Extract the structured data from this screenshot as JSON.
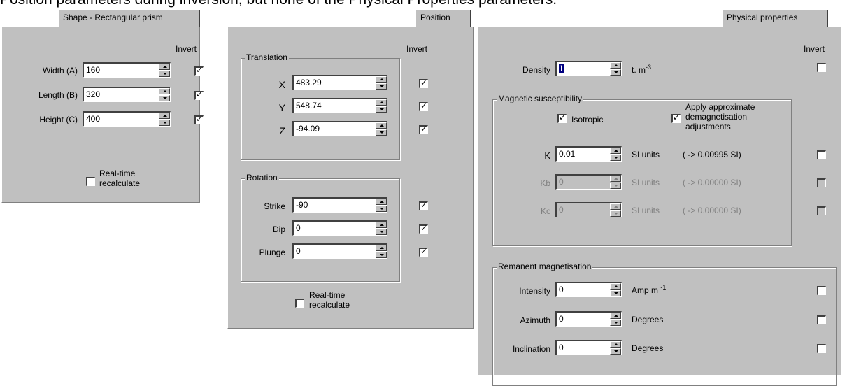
{
  "caption": "Position parameters during inversion, but none of the Physical Properties parameters.",
  "shape": {
    "tab": "Shape - Rectangular prism",
    "invert_label": "Invert",
    "rows": [
      {
        "label": "Width (A)",
        "value": "160",
        "invert": true
      },
      {
        "label": "Length (B)",
        "value": "320",
        "invert": true
      },
      {
        "label": "Height (C)",
        "value": "400",
        "invert": true
      }
    ],
    "realtime": {
      "label_line1": "Real-time",
      "label_line2": "recalculate",
      "checked": false
    }
  },
  "position": {
    "tab": "Position",
    "invert_label": "Invert",
    "translation": {
      "label": "Translation",
      "rows": [
        {
          "label": "X",
          "value": "483.29",
          "invert": true
        },
        {
          "label": "Y",
          "value": "548.74",
          "invert": true
        },
        {
          "label": "Z",
          "value": "-94.09",
          "invert": true
        }
      ]
    },
    "rotation": {
      "label": "Rotation",
      "rows": [
        {
          "label": "Strike",
          "value": "-90",
          "invert": true
        },
        {
          "label": "Dip",
          "value": "0",
          "invert": true
        },
        {
          "label": "Plunge",
          "value": "0",
          "invert": true
        }
      ]
    },
    "realtime": {
      "label_line1": "Real-time",
      "label_line2": "recalculate",
      "checked": false
    }
  },
  "physical": {
    "tab": "Physical properties",
    "invert_label": "Invert",
    "density": {
      "label": "Density",
      "value": "1",
      "unit": "t. m",
      "unit_sup": "-3",
      "invert": false
    },
    "susceptibility": {
      "label": "Magnetic susceptibility",
      "isotropic": {
        "label": "Isotropic",
        "checked": true
      },
      "demag": {
        "line1": "Apply approximate",
        "line2": "demagnetisation",
        "line3": "adjustments",
        "checked": true
      },
      "rows": [
        {
          "label": "K",
          "value": "0.01",
          "unit": "SI units",
          "calc": "( -> 0.00995 SI)",
          "invert": false,
          "disabled": false
        },
        {
          "label": "Kb",
          "value": "0",
          "unit": "SI units",
          "calc": "( -> 0.00000 SI)",
          "invert": false,
          "disabled": true
        },
        {
          "label": "Kc",
          "value": "0",
          "unit": "SI units",
          "calc": "( -> 0.00000 SI)",
          "invert": false,
          "disabled": true
        }
      ]
    },
    "remanent": {
      "label": "Remanent magnetisation",
      "rows": [
        {
          "label": "Intensity",
          "value": "0",
          "unit": "Amp m",
          "unit_sup": "-1",
          "invert": false
        },
        {
          "label": "Azimuth",
          "value": "0",
          "unit": "Degrees",
          "invert": false
        },
        {
          "label": "Inclination",
          "value": "0",
          "unit": "Degrees",
          "invert": false
        }
      ]
    }
  }
}
